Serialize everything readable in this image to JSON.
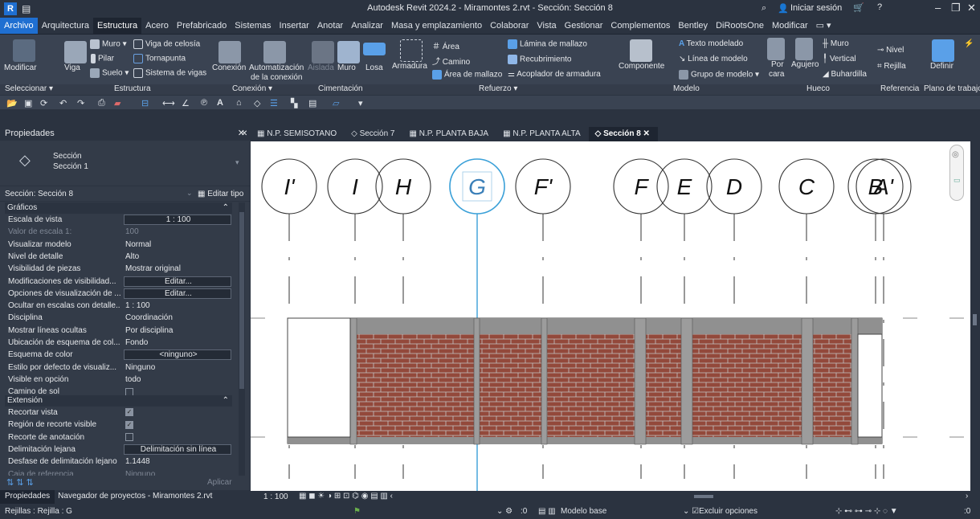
{
  "title": "Autodesk Revit 2024.2 - Miramontes 2.rvt - Sección: Sección 8",
  "title_right": {
    "signin": "Iniciar sesión"
  },
  "menu": [
    "Archivo",
    "Arquitectura",
    "Estructura",
    "Acero",
    "Prefabricado",
    "Sistemas",
    "Insertar",
    "Anotar",
    "Analizar",
    "Masa y emplazamiento",
    "Colaborar",
    "Vista",
    "Gestionar",
    "Complementos",
    "Bentley",
    "DiRootsOne",
    "Modificar"
  ],
  "active_menu": "Estructura",
  "ribbon": {
    "modificar": "Modificar",
    "viga": "Viga",
    "muro": "Muro",
    "viga_celosia": "Viga de celosía",
    "pilar": "Pilar",
    "tornapunta": "Tornapunta",
    "suelo": "Suelo",
    "sistema_vigas": "Sistema de vigas",
    "conexion": "Conexión",
    "automatizacion": "Automatización",
    "de_la_conexion": "de la conexión",
    "aislada": "Aislada",
    "muro2": "Muro",
    "losa": "Losa",
    "armadura": "Armadura",
    "area": "Área",
    "camino": "Camino",
    "area_mallazo": "Área de mallazo",
    "lamina_mallazo": "Lámina de mallazo",
    "recubrimiento": "Recubrimiento",
    "acoplador": "Acoplador de armadura",
    "componente": "Componente",
    "texto_modelado": "Texto modelado",
    "linea_modelo": "Línea de modelo",
    "grupo_modelo": "Grupo de modelo",
    "por": "Por",
    "cara": "cara",
    "agujero": "Agujero",
    "muro3": "Muro",
    "vertical": "Vertical",
    "buhardilla": "Buhardilla",
    "nivel": "Nivel",
    "rejilla": "Rejilla",
    "definir": "Definir",
    "groups": [
      "Seleccionar",
      "Estructura",
      "Conexión",
      "Cimentación",
      "Refuerzo",
      "Modelo",
      "Hueco",
      "Referencia",
      "Plano de trabajo"
    ]
  },
  "properties": {
    "header": "Propiedades",
    "type_line1": "Sección",
    "type_line2": "Sección 1",
    "instance": "Sección: Sección 8",
    "edit_type": "Editar tipo",
    "section_graficos": "Gráficos",
    "rows": [
      {
        "k": "Escala de vista",
        "v": "1 : 100",
        "style": "box"
      },
      {
        "k": "Valor de escala   1:",
        "v": "100",
        "style": "dim"
      },
      {
        "k": "Visualizar modelo",
        "v": "Normal",
        "style": ""
      },
      {
        "k": "Nivel de detalle",
        "v": "Alto",
        "style": ""
      },
      {
        "k": "Visibilidad de piezas",
        "v": "Mostrar original",
        "style": ""
      },
      {
        "k": "Modificaciones de visibilidad...",
        "v": "Editar...",
        "style": "box"
      },
      {
        "k": "Opciones de visualización de ...",
        "v": "Editar...",
        "style": "box"
      },
      {
        "k": "Ocultar en escalas con detalle...",
        "v": "1 : 100",
        "style": ""
      },
      {
        "k": "Disciplina",
        "v": "Coordinación",
        "style": ""
      },
      {
        "k": "Mostrar líneas ocultas",
        "v": "Por disciplina",
        "style": ""
      },
      {
        "k": "Ubicación de esquema de col...",
        "v": "Fondo",
        "style": ""
      },
      {
        "k": "Esquema de color",
        "v": "<ninguno>",
        "style": "box"
      },
      {
        "k": "Estilo por defecto de visualiz...",
        "v": "Ninguno",
        "style": ""
      },
      {
        "k": "Visible en opción",
        "v": "todo",
        "style": ""
      },
      {
        "k": "Camino de sol",
        "v": "",
        "style": "chk"
      }
    ],
    "section_extension": "Extensión",
    "rows2": [
      {
        "k": "Recortar vista",
        "v": "",
        "style": "chkon"
      },
      {
        "k": "Región de recorte visible",
        "v": "",
        "style": "chkon"
      },
      {
        "k": "Recorte de anotación",
        "v": "",
        "style": "chk"
      },
      {
        "k": "Delimitación lejana",
        "v": "Delimitación sin línea",
        "style": "box"
      },
      {
        "k": "Desfase de delimitación lejano",
        "v": "1.1448",
        "style": ""
      },
      {
        "k": "Caja de referencia",
        "v": "Ninguno",
        "style": "dim"
      }
    ],
    "apply": "Aplicar",
    "bottom_tabs": [
      "Propiedades",
      "Navegador de proyectos - Miramontes 2.rvt"
    ]
  },
  "view_tabs": [
    "N.P. SEMISOTANO",
    "Sección 7",
    "N.P. PLANTA BAJA",
    "N.P. PLANTA ALTA",
    "Sección 8"
  ],
  "active_tab": "Sección 8",
  "grid_labels": [
    "I'",
    "I",
    "H",
    "G",
    "F'",
    "F",
    "E",
    "D",
    "C",
    "B",
    "A'"
  ],
  "selected_grid": "G",
  "view_scale": "1 : 100",
  "status": {
    "left": "Rejillas : Rejilla : G",
    "zero1": ":0",
    "modelo": "Modelo base",
    "excluir": "Excluir opciones",
    "zero2": ":0"
  }
}
